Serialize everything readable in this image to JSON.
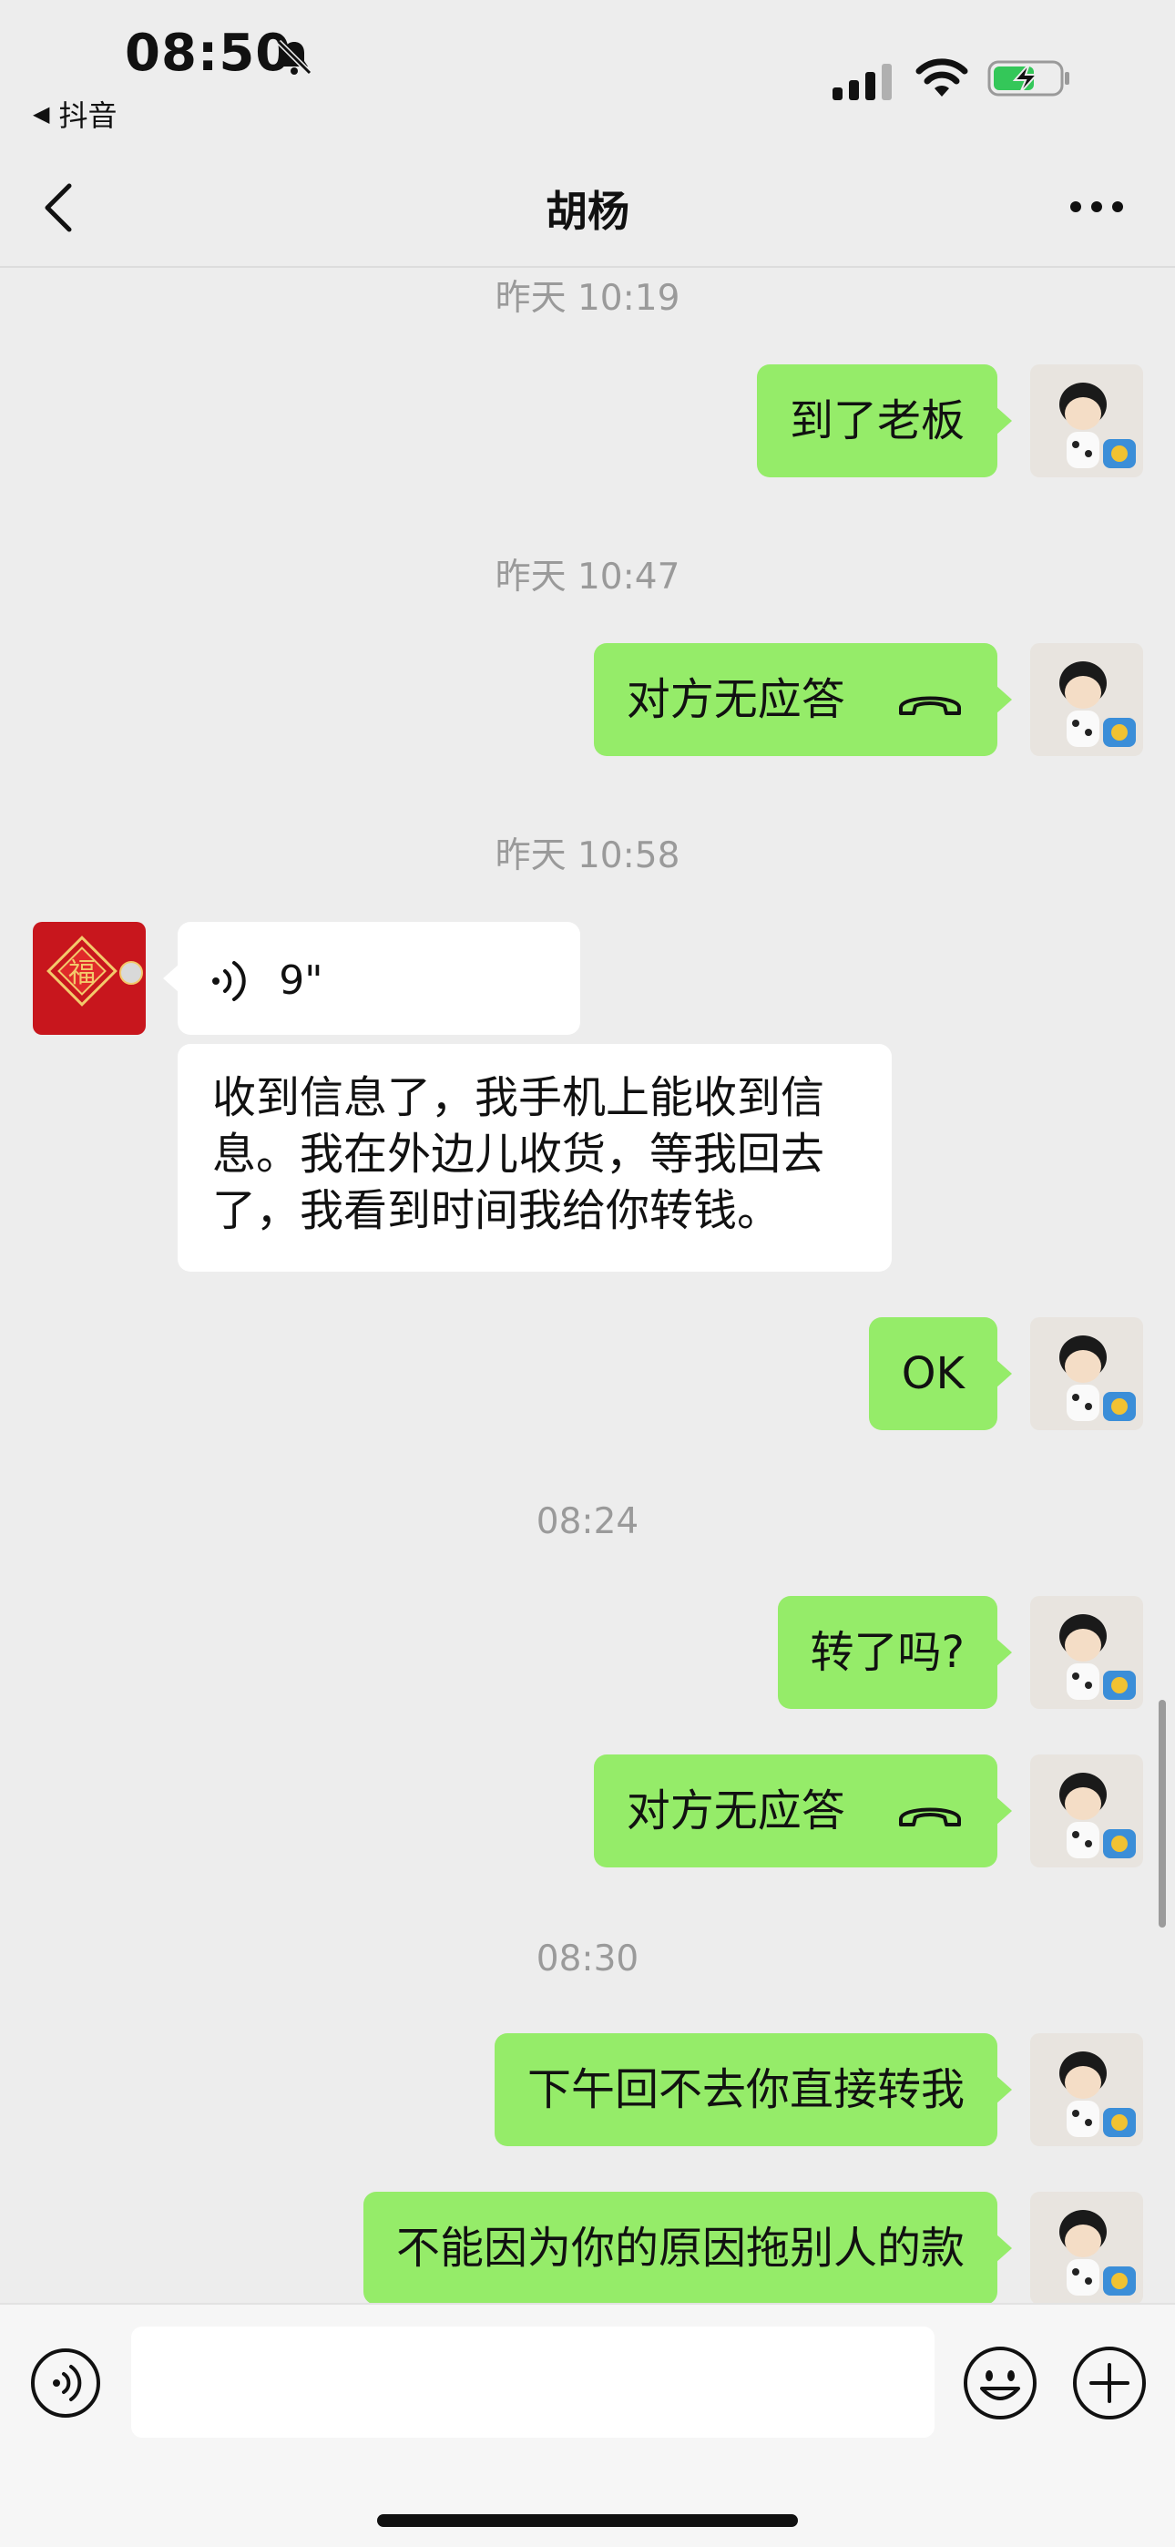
{
  "status_bar": {
    "time": "08:50",
    "back_app": "抖音",
    "icons": [
      "bell-muted-icon",
      "signal-icon",
      "wifi-icon",
      "battery-charging-icon"
    ]
  },
  "nav": {
    "title": "胡杨",
    "back_icon": "chevron-left-icon",
    "more_icon": "more-dots-icon"
  },
  "messages": {
    "ts1": "昨天 10:19",
    "m1": "到了老板",
    "ts2": "昨天 10:47",
    "m2": "对方无应答",
    "ts3": "昨天 10:58",
    "voice_duration": "9\"",
    "m4": "收到信息了，我手机上能收到信息。我在外边儿收货，等我回去了，我看到时间我给你转钱。",
    "m5": "OK",
    "ts4": "08:24",
    "m6": "转了吗?",
    "m7": "对方无应答",
    "ts5": "08:30",
    "m8": "下午回不去你直接转我",
    "m9": "不能因为你的原因拖别人的款"
  },
  "input_bar": {
    "icons": [
      "voice-input-icon",
      "emoji-icon",
      "plus-icon"
    ]
  },
  "colors": {
    "background": "#ededed",
    "my_bubble": "#95ec69",
    "other_bubble": "#ffffff",
    "timestamp": "#9a9a9a"
  }
}
